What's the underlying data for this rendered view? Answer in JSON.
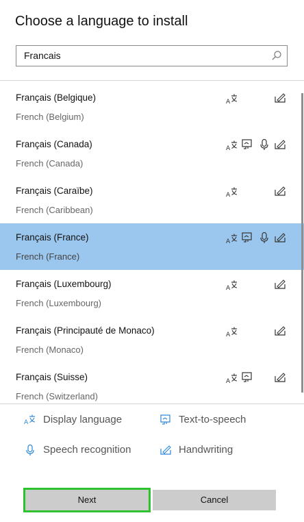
{
  "dialog": {
    "title": "Choose a language to install"
  },
  "search": {
    "value": "Francais"
  },
  "languages": [
    {
      "name": "Français (Belgique)",
      "subtitle": "French (Belgium)",
      "features": [
        "display-language",
        "handwriting"
      ],
      "selected": false
    },
    {
      "name": "Français (Canada)",
      "subtitle": "French (Canada)",
      "features": [
        "display-language",
        "text-to-speech",
        "speech-recognition",
        "handwriting"
      ],
      "selected": false
    },
    {
      "name": "Français (Caraïbe)",
      "subtitle": "French (Caribbean)",
      "features": [
        "display-language",
        "handwriting"
      ],
      "selected": false
    },
    {
      "name": "Français (France)",
      "subtitle": "French (France)",
      "features": [
        "display-language",
        "text-to-speech",
        "speech-recognition",
        "handwriting"
      ],
      "selected": true
    },
    {
      "name": "Français (Luxembourg)",
      "subtitle": "French (Luxembourg)",
      "features": [
        "display-language",
        "handwriting"
      ],
      "selected": false
    },
    {
      "name": "Français (Principauté de Monaco)",
      "subtitle": "French (Monaco)",
      "features": [
        "display-language",
        "handwriting"
      ],
      "selected": false
    },
    {
      "name": "Français (Suisse)",
      "subtitle": "French (Switzerland)",
      "features": [
        "display-language",
        "text-to-speech",
        "handwriting"
      ],
      "selected": false
    }
  ],
  "legend": {
    "display_language": "Display language",
    "text_to_speech": "Text-to-speech",
    "speech_recognition": "Speech recognition",
    "handwriting": "Handwriting"
  },
  "buttons": {
    "next": "Next",
    "cancel": "Cancel"
  },
  "colors": {
    "selected_row": "#9bc7ee",
    "legend_icon": "#2a86d9",
    "next_focus_outline": "#2fc22f"
  }
}
